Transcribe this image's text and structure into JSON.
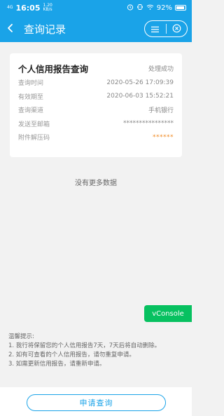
{
  "status_bar": {
    "carrier": "4G",
    "time": "16:05",
    "speed": "1.20",
    "speed_unit": "KB/s",
    "battery": "92%"
  },
  "header": {
    "title": "查询记录",
    "back_icon": "back-arrow-icon",
    "menu_icon": "menu-icon",
    "close_icon": "close-circle-icon"
  },
  "record": {
    "title": "个人信用报告查询",
    "status": "处理成功",
    "rows": [
      {
        "label": "查询时间",
        "value": "2020-05-26 17:09:39"
      },
      {
        "label": "有效期至",
        "value": "2020-06-03 15:52:21"
      },
      {
        "label": "查询渠道",
        "value": "手机银行"
      },
      {
        "label": "发送至邮箱",
        "value": "****************"
      },
      {
        "label": "附件解压码",
        "value": "******"
      }
    ]
  },
  "no_more_text": "没有更多数据",
  "vconsole_label": "vConsole",
  "tips": {
    "title": "温馨提示:",
    "items": [
      "1. 我行将保留您的个人信用报告7天，7天后将自动删除。",
      "2. 如有可查看的个人信用报告，请勿重复申请。",
      "3. 如需更新信用报告，请重新申请。"
    ]
  },
  "apply_button": "申请查询",
  "colors": {
    "primary": "#1aa3e8",
    "orange": "#f08a24",
    "green": "#07c160"
  }
}
